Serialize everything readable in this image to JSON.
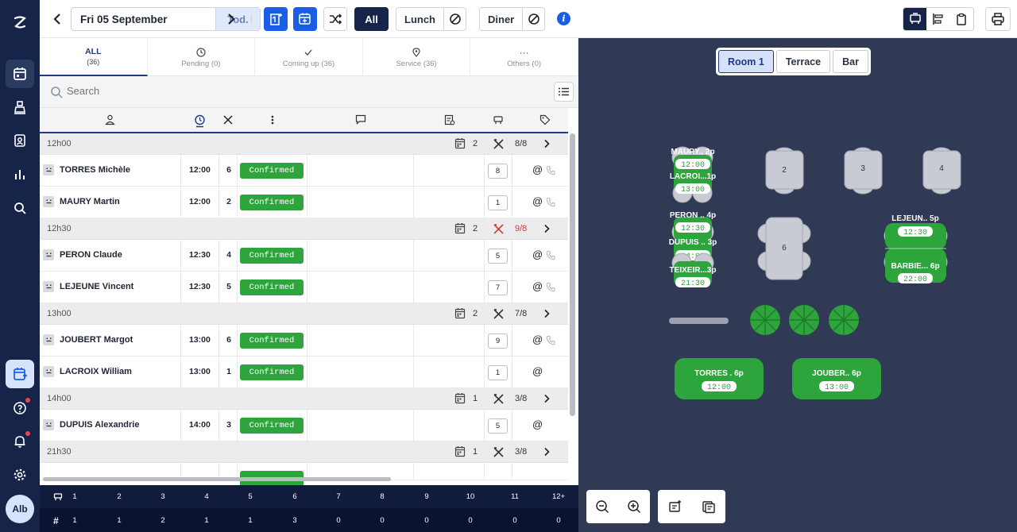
{
  "rail": {
    "avatar": "Alb"
  },
  "topbar": {
    "date": "Fri 05 September",
    "today": "Tod.",
    "all": "All",
    "lunch": "Lunch",
    "diner": "Diner",
    "info": "i"
  },
  "tabs": [
    {
      "name": "ALL",
      "count": "(36)"
    },
    {
      "name": "Pending (0)"
    },
    {
      "name": "Coming up (36)"
    },
    {
      "name": "Service (36)"
    },
    {
      "name": "Others (0)"
    }
  ],
  "search": {
    "placeholder": "Search"
  },
  "groups": [
    {
      "time": "12h00",
      "count": "2",
      "ratio": "8/8",
      "over": false,
      "rows": [
        {
          "name": "TORRES Michèle",
          "time": "12:00",
          "covers": "6",
          "status": "Confirmed",
          "table": "8",
          "phone": true
        },
        {
          "name": "MAURY Martin",
          "time": "12:00",
          "covers": "2",
          "status": "Confirmed",
          "table": "1",
          "phone": true
        }
      ]
    },
    {
      "time": "12h30",
      "count": "2",
      "ratio": "9/8",
      "over": true,
      "rows": [
        {
          "name": "PERON Claude",
          "time": "12:30",
          "covers": "4",
          "status": "Confirmed",
          "table": "5",
          "phone": true
        },
        {
          "name": "LEJEUNE Vincent",
          "time": "12:30",
          "covers": "5",
          "status": "Confirmed",
          "table": "7",
          "phone": true
        }
      ]
    },
    {
      "time": "13h00",
      "count": "2",
      "ratio": "7/8",
      "over": false,
      "rows": [
        {
          "name": "JOUBERT Margot",
          "time": "13:00",
          "covers": "6",
          "status": "Confirmed",
          "table": "9",
          "phone": true
        },
        {
          "name": "LACROIX William",
          "time": "13:00",
          "covers": "1",
          "status": "Confirmed",
          "table": "1",
          "phone": false
        }
      ]
    },
    {
      "time": "14h00",
      "count": "1",
      "ratio": "3/8",
      "over": false,
      "rows": [
        {
          "name": "DUPUIS Alexandrie",
          "time": "14:00",
          "covers": "3",
          "status": "Confirmed",
          "table": "5",
          "phone": false
        }
      ]
    },
    {
      "time": "21h30",
      "count": "1",
      "ratio": "3/8",
      "over": false,
      "rows": []
    }
  ],
  "stats": {
    "tables_header": [
      "1",
      "2",
      "3",
      "4",
      "5",
      "6",
      "7",
      "8",
      "9",
      "10",
      "11",
      "12+"
    ],
    "counts": [
      "1",
      "1",
      "2",
      "1",
      "1",
      "3",
      "0",
      "0",
      "0",
      "0",
      "0",
      "0"
    ],
    "hash": "#"
  },
  "floor": {
    "rooms": [
      "Room 1",
      "Terrace",
      "Bar"
    ],
    "active_room": "Room 1",
    "tables": [
      {
        "label": "MAURY.. 2p",
        "time": "12:00"
      },
      {
        "label": "LACROI...1p",
        "time": "13:00"
      },
      {
        "label": "2"
      },
      {
        "label": "3"
      },
      {
        "label": "4"
      },
      {
        "label": "PERON .. 4p",
        "time": "12:30"
      },
      {
        "label": "DUPUIS .. 3p",
        "time": "14:00"
      },
      {
        "label": "TEIXEIR...3p",
        "time": "21:30"
      },
      {
        "label": "6"
      },
      {
        "label": "LEJEUN.. 5p",
        "time": "12:30"
      },
      {
        "label": "BARBIE... 6p",
        "time": "22:00"
      },
      {
        "label": "TORRES . 6p",
        "time": "12:00"
      },
      {
        "label": "JOUBER.. 6p",
        "time": "13:00"
      }
    ]
  },
  "colors": {
    "navy": "#162449",
    "blue": "#1a5ee8",
    "green": "#2ea43c",
    "floor": "#313a55"
  }
}
